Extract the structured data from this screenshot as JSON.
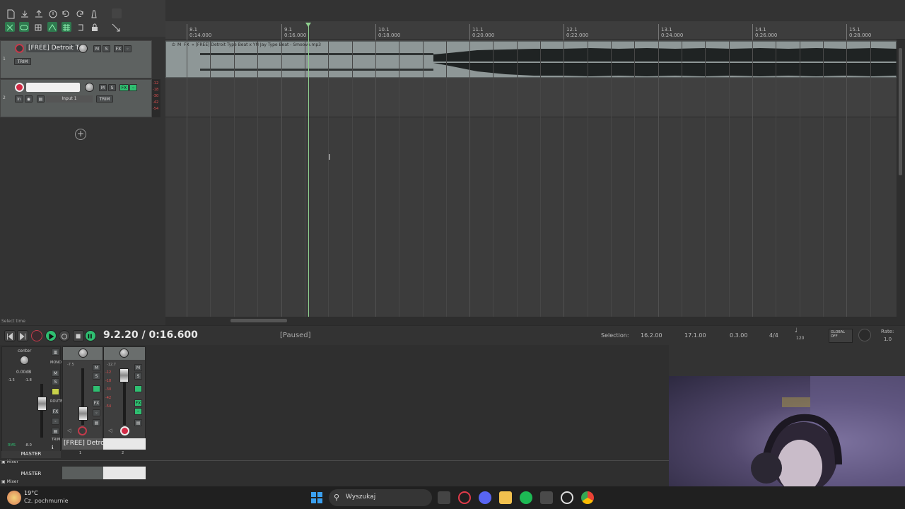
{
  "ruler": {
    "marks": [
      {
        "bar": "8.1",
        "time": "0:14.000"
      },
      {
        "bar": "9.1",
        "time": "0:16.000"
      },
      {
        "bar": "10.1",
        "time": "0:18.000"
      },
      {
        "bar": "11.1",
        "time": "0:20.000"
      },
      {
        "bar": "12.1",
        "time": "0:22.000"
      },
      {
        "bar": "13.1",
        "time": "0:24.000"
      },
      {
        "bar": "14.1",
        "time": "0:26.000"
      },
      {
        "bar": "15.1",
        "time": "0:28.000"
      }
    ]
  },
  "tracks": [
    {
      "number": "1",
      "name": "[FREE] Detroit Typ",
      "mute": "M",
      "solo": "S",
      "fx": "FX",
      "trim": "TRIM"
    },
    {
      "number": "2",
      "name": "",
      "mute": "M",
      "solo": "S",
      "fx": "FX",
      "input": "Input 1",
      "trim": "TRIM",
      "in_label": "in"
    }
  ],
  "meter_scale": [
    "-12",
    "-18",
    "-30",
    "-42",
    "-54"
  ],
  "item": {
    "label": "« [FREE] Detroit Type Beat x YN Jay Type Beat - Smoove.mp3",
    "m": "M",
    "fx": "FX"
  },
  "transport": {
    "position": "9.2.20 / 0:16.600",
    "status": "[Paused]",
    "select_label": "Select time",
    "selection_label": "Selection:",
    "sel_start": "16.2.00",
    "sel_end": "17.1.00",
    "sel_len": "0.3.00",
    "time_sig": "4/4",
    "bpm": "120",
    "global_label": "GLOBAL",
    "global_state": "OFF",
    "rate_label": "Rate:",
    "rate_value": "1.0"
  },
  "mixer": {
    "master_pan": "center",
    "master_vol": "0.00dB",
    "master_peaks": [
      "-1.5",
      "-1.8"
    ],
    "master_label": "MASTER",
    "mixer_label": "Mixer",
    "mono": "MONO",
    "route": "ROUTE",
    "trim": "TRIM",
    "rms": "RMS",
    "rms_val": "-8.0",
    "m": "M",
    "s": "S",
    "fx": "FX",
    "track1_name": "[FREE] Detroi",
    "track1_num": "1",
    "track2_num": "2",
    "track1_db": "-7.5",
    "track2_db": "-12.7"
  },
  "taskbar": {
    "weather_temp": "19°C",
    "weather_desc": "Cz. pochmurnie",
    "search": "Wyszukaj"
  },
  "colors": {
    "accent_green": "#2fbf71",
    "rec_red": "#d22a45",
    "playhead": "#8fd08f"
  }
}
